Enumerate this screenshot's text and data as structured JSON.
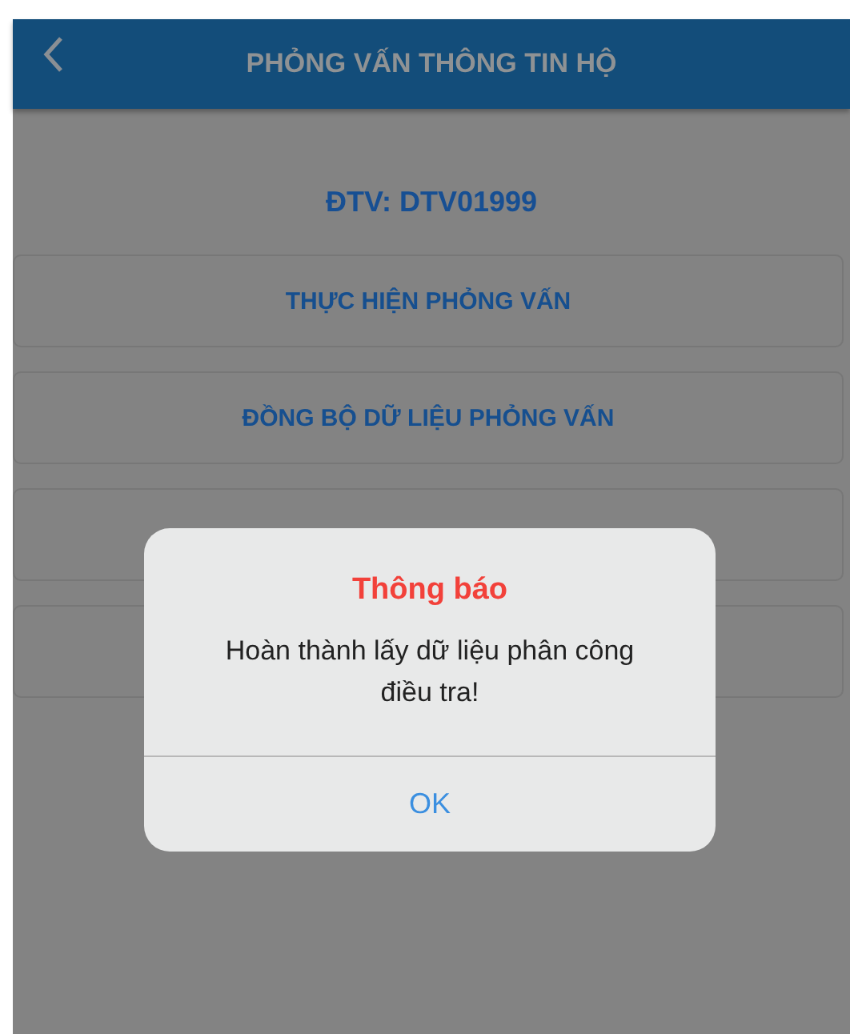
{
  "header": {
    "title": "PHỎNG VẤN THÔNG TIN HỘ"
  },
  "interviewer": "ĐTV: DTV01999",
  "buttons": [
    {
      "kind": "labeled",
      "label": "THỰC HIỆN PHỎNG VẤN"
    },
    {
      "kind": "labeled",
      "label": "ĐỒNG BỘ DỮ LIỆU PHỎNG VẤN"
    },
    {
      "kind": "covered"
    },
    {
      "kind": "covered"
    }
  ],
  "dialog": {
    "title": "Thông báo",
    "message": "Hoàn thành lấy dữ liệu phân công điều tra!",
    "button": "OK"
  }
}
